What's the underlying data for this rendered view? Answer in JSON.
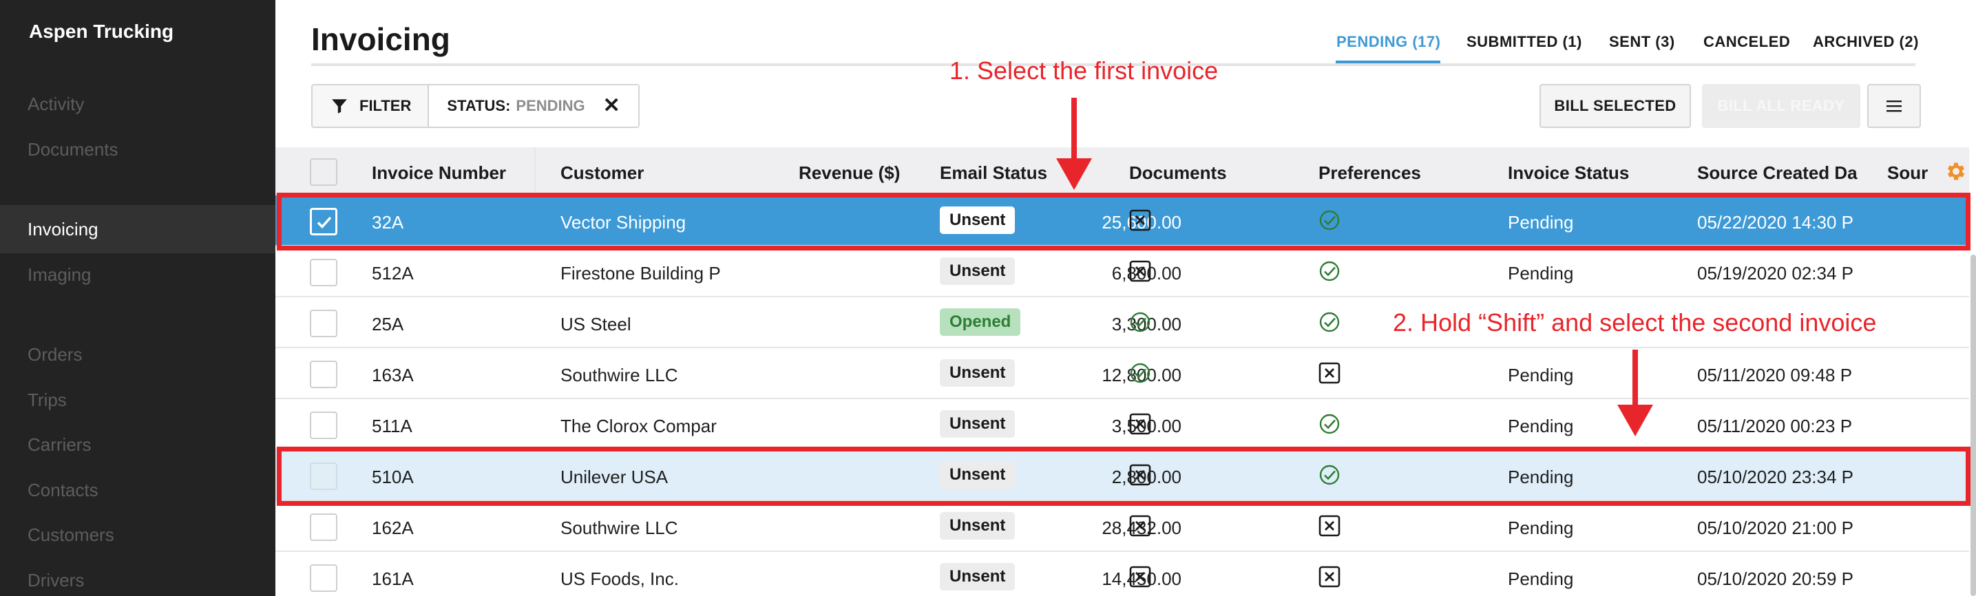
{
  "app": {
    "brand": "Aspen Trucking"
  },
  "sidebar": {
    "items": [
      {
        "label": "Activity",
        "active": false
      },
      {
        "label": "Documents",
        "active": false
      },
      {
        "label": "Invoicing",
        "active": true
      },
      {
        "label": "Imaging",
        "active": false
      },
      {
        "label": "Orders",
        "active": false
      },
      {
        "label": "Trips",
        "active": false
      },
      {
        "label": "Carriers",
        "active": false
      },
      {
        "label": "Contacts",
        "active": false
      },
      {
        "label": "Customers",
        "active": false
      },
      {
        "label": "Drivers",
        "active": false
      }
    ]
  },
  "header": {
    "title": "Invoicing",
    "tabs": [
      {
        "label": "PENDING (17)",
        "active": true
      },
      {
        "label": "SUBMITTED (1)",
        "active": false
      },
      {
        "label": "SENT (3)",
        "active": false
      },
      {
        "label": "CANCELED",
        "active": false
      },
      {
        "label": "ARCHIVED (2)",
        "active": false
      }
    ]
  },
  "toolbar": {
    "filter_label": "FILTER",
    "status_key": "STATUS:",
    "status_value": "PENDING",
    "bill_selected_label": "BILL SELECTED",
    "bill_all_ready_label": "BILL ALL READY"
  },
  "table": {
    "columns": [
      "Invoice Number",
      "Customer",
      "Revenue ($)",
      "Email Status",
      "Documents",
      "Preferences",
      "Invoice Status",
      "Source Created Da",
      "Sour"
    ],
    "rows": [
      {
        "invoice": "32A",
        "customer": "Vector Shipping",
        "revenue": "25,600.00",
        "email": "Unsent",
        "documents": "x",
        "preferences": "check",
        "status": "Pending",
        "created": "05/22/2020 14:30 P",
        "state": "selected"
      },
      {
        "invoice": "512A",
        "customer": "Firestone Building P",
        "revenue": "6,800.00",
        "email": "Unsent",
        "documents": "x",
        "preferences": "check",
        "status": "Pending",
        "created": "05/19/2020 02:34 P",
        "state": "none"
      },
      {
        "invoice": "25A",
        "customer": "US Steel",
        "revenue": "3,300.00",
        "email": "Opened",
        "documents": "check",
        "preferences": "check",
        "status": "",
        "created": "",
        "state": "none"
      },
      {
        "invoice": "163A",
        "customer": "Southwire LLC",
        "revenue": "12,800.00",
        "email": "Unsent",
        "documents": "check",
        "preferences": "x",
        "status": "Pending",
        "created": "05/11/2020 09:48 P",
        "state": "none"
      },
      {
        "invoice": "511A",
        "customer": "The Clorox Compar",
        "revenue": "3,500.00",
        "email": "Unsent",
        "documents": "x",
        "preferences": "check",
        "status": "Pending",
        "created": "05/11/2020 00:23 P",
        "state": "none"
      },
      {
        "invoice": "510A",
        "customer": "Unilever USA",
        "revenue": "2,800.00",
        "email": "Unsent",
        "documents": "x",
        "preferences": "check",
        "status": "Pending",
        "created": "05/10/2020 23:34 P",
        "state": "shift"
      },
      {
        "invoice": "162A",
        "customer": "Southwire LLC",
        "revenue": "28,432.00",
        "email": "Unsent",
        "documents": "x",
        "preferences": "x",
        "status": "Pending",
        "created": "05/10/2020 21:00 P",
        "state": "none"
      },
      {
        "invoice": "161A",
        "customer": "US Foods, Inc.",
        "revenue": "14,450.00",
        "email": "Unsent",
        "documents": "x",
        "preferences": "x",
        "status": "Pending",
        "created": "05/10/2020 20:59 P",
        "state": "none"
      }
    ]
  },
  "annotations": {
    "step1": "1. Select the first invoice",
    "step2": "2. Hold “Shift” and select the second invoice"
  },
  "colors": {
    "accent": "#3d9ad6",
    "annotation": "#e8252b",
    "gear": "#f0902a",
    "success": "#2e7d34"
  }
}
